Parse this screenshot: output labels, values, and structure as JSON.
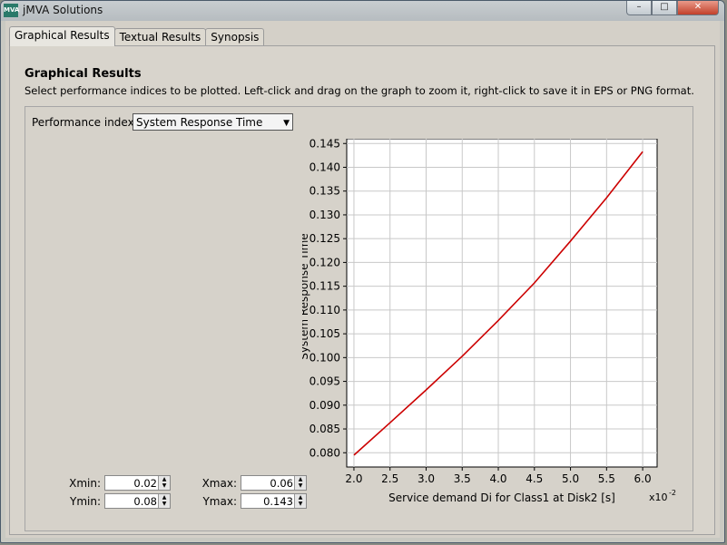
{
  "window": {
    "title": "jMVA Solutions",
    "icon_text": "MVA",
    "minimize": "–",
    "maximize": "□",
    "close": "✕"
  },
  "tabs": [
    {
      "label": "Graphical Results"
    },
    {
      "label": "Textual Results"
    },
    {
      "label": "Synopsis"
    }
  ],
  "panel": {
    "heading": "Graphical Results",
    "subtitle": "Select performance indices to be plotted. Left-click and drag on the graph to zoom it, right-click to save it in EPS or PNG format.",
    "perf_label": "Performance index:",
    "perf_value": "System Response Time"
  },
  "controls": {
    "xmin_label": "Xmin:",
    "xmin": "0.02",
    "xmax_label": "Xmax:",
    "xmax": "0.06",
    "ymin_label": "Ymin:",
    "ymin": "0.08",
    "ymax_label": "Ymax:",
    "ymax": "0.143"
  },
  "chart_data": {
    "type": "line",
    "xlabel": "Service demand Di for Class1 at Disk2 [s]",
    "ylabel": "System Response Time",
    "x_multiplier": "x10",
    "x_multiplier_exp": "-2",
    "xlim": [
      1.9,
      6.2
    ],
    "ylim": [
      0.077,
      0.146
    ],
    "x_ticks": [
      "2.0",
      "2.5",
      "3.0",
      "3.5",
      "4.0",
      "4.5",
      "5.0",
      "5.5",
      "6.0"
    ],
    "y_ticks": [
      "0.080",
      "0.085",
      "0.090",
      "0.095",
      "0.100",
      "0.105",
      "0.110",
      "0.115",
      "0.120",
      "0.125",
      "0.130",
      "0.135",
      "0.140",
      "0.145"
    ],
    "grid": true,
    "line_color": "#cc0000",
    "series": [
      {
        "x": [
          2.0,
          2.5,
          3.0,
          3.5,
          4.0,
          4.5,
          5.0,
          5.5,
          6.0
        ],
        "y": [
          0.0795,
          0.0863,
          0.0932,
          0.1003,
          0.1078,
          0.1157,
          0.1245,
          0.1336,
          0.1433
        ]
      }
    ]
  }
}
